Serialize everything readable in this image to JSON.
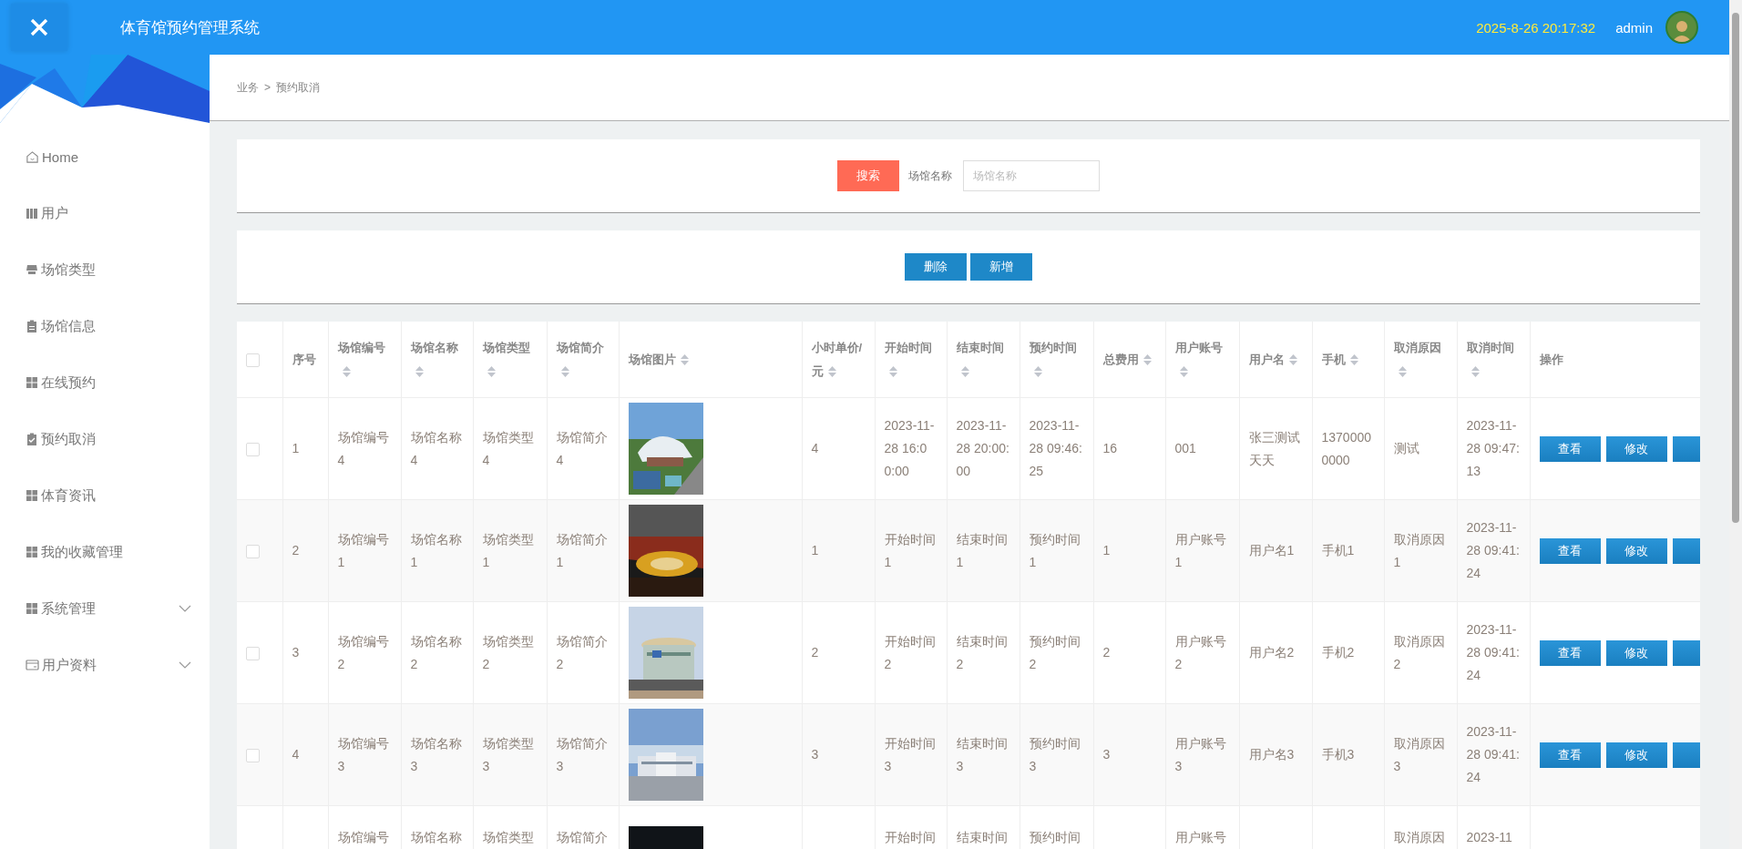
{
  "header": {
    "title": "体育馆预约管理系统",
    "datetime": "2025-8-26 20:17:32",
    "user": "admin"
  },
  "sidebar": {
    "items": [
      {
        "label": "Home",
        "kind": "home",
        "has_submenu": false
      },
      {
        "label": "用户",
        "kind": "books",
        "has_submenu": false
      },
      {
        "label": "场馆类型",
        "kind": "store",
        "has_submenu": false
      },
      {
        "label": "场馆信息",
        "kind": "clipboard",
        "has_submenu": false
      },
      {
        "label": "在线预约",
        "kind": "grid",
        "has_submenu": false
      },
      {
        "label": "预约取消",
        "kind": "clipboard-check",
        "has_submenu": false
      },
      {
        "label": "体育资讯",
        "kind": "grid",
        "has_submenu": false
      },
      {
        "label": "我的收藏管理",
        "kind": "grid",
        "has_submenu": false
      },
      {
        "label": "系统管理",
        "kind": "grid",
        "has_submenu": true
      },
      {
        "label": "用户资料",
        "kind": "wallet",
        "has_submenu": true
      }
    ]
  },
  "breadcrumb": {
    "items": [
      "业务",
      "预约取消"
    ],
    "separator": ">"
  },
  "search": {
    "button": "搜索",
    "label": "场馆名称",
    "placeholder": "场馆名称"
  },
  "actions": [
    "删除",
    "新增"
  ],
  "table": {
    "all_checked": false,
    "columns": [
      {
        "kind": "check"
      },
      {
        "kind": "text",
        "label": "序号",
        "sortable": false
      },
      {
        "kind": "text",
        "label": "场馆编号",
        "sortable": true
      },
      {
        "kind": "text",
        "label": "场馆名称",
        "sortable": true
      },
      {
        "kind": "text",
        "label": "场馆类型",
        "sortable": true
      },
      {
        "kind": "text",
        "label": "场馆简介",
        "sortable": true
      },
      {
        "label": "场馆图片",
        "sortable": true
      },
      {
        "kind": "text",
        "label": "小时单价/元",
        "sortable": true
      },
      {
        "kind": "text",
        "label": "开始时间",
        "sortable": true
      },
      {
        "kind": "text",
        "label": "结束时间",
        "sortable": true
      },
      {
        "kind": "text",
        "label": "预约时间",
        "sortable": true
      },
      {
        "kind": "text",
        "label": "总费用",
        "sortable": true
      },
      {
        "kind": "text",
        "label": "用户账号",
        "sortable": true
      },
      {
        "kind": "text",
        "label": "用户名",
        "sortable": true
      },
      {
        "kind": "text",
        "label": "手机",
        "sortable": true
      },
      {
        "kind": "text",
        "label": "取消原因",
        "sortable": true
      },
      {
        "kind": "text",
        "label": "取消时间",
        "sortable": true
      },
      {
        "kind": "actions",
        "label": "操作",
        "sortable": false
      }
    ],
    "rows": [
      {
        "checked": false,
        "cells": [
          "",
          "1",
          "场馆编号4",
          "场馆名称4",
          "场馆类型4",
          "场馆简介4",
          "",
          "4",
          "2023-11-28 16:00:00",
          "2023-11-28 20:00:00",
          "2023-11-28 09:46:25",
          "16",
          "001",
          "张三测试天天",
          "13700000000",
          "测试",
          "2023-11-28 09:47:13",
          ""
        ],
        "actions": [
          "查看",
          "修改"
        ],
        "clipped_button": true
      },
      {
        "checked": false,
        "cells": [
          "",
          "2",
          "场馆编号1",
          "场馆名称1",
          "场馆类型1",
          "场馆简介1",
          "",
          "1",
          "开始时间1",
          "结束时间1",
          "预约时间1",
          "1",
          "用户账号1",
          "用户名1",
          "手机1",
          "取消原因1",
          "2023-11-28 09:41:24",
          ""
        ],
        "actions": [
          "查看",
          "修改"
        ],
        "clipped_button": true
      },
      {
        "checked": false,
        "cells": [
          "",
          "3",
          "场馆编号2",
          "场馆名称2",
          "场馆类型2",
          "场馆简介2",
          "",
          "2",
          "开始时间2",
          "结束时间2",
          "预约时间2",
          "2",
          "用户账号2",
          "用户名2",
          "手机2",
          "取消原因2",
          "2023-11-28 09:41:24",
          ""
        ],
        "actions": [
          "查看",
          "修改"
        ],
        "clipped_button": true
      },
      {
        "checked": false,
        "cells": [
          "",
          "4",
          "场馆编号3",
          "场馆名称3",
          "场馆类型3",
          "场馆简介3",
          "",
          "3",
          "开始时间3",
          "结束时间3",
          "预约时间3",
          "3",
          "用户账号3",
          "用户名3",
          "手机3",
          "取消原因3",
          "2023-11-28 09:41:24",
          ""
        ],
        "actions": [
          "查看",
          "修改"
        ],
        "clipped_button": true
      },
      {
        "cells": [
          "",
          "",
          "场馆编号",
          "场馆名称",
          "场馆类型",
          "场馆简介",
          "",
          "",
          "开始时间",
          "结束时间",
          "预约时间",
          "",
          "用户账号",
          "",
          "",
          "取消原因",
          "2023-11",
          ""
        ]
      }
    ]
  }
}
